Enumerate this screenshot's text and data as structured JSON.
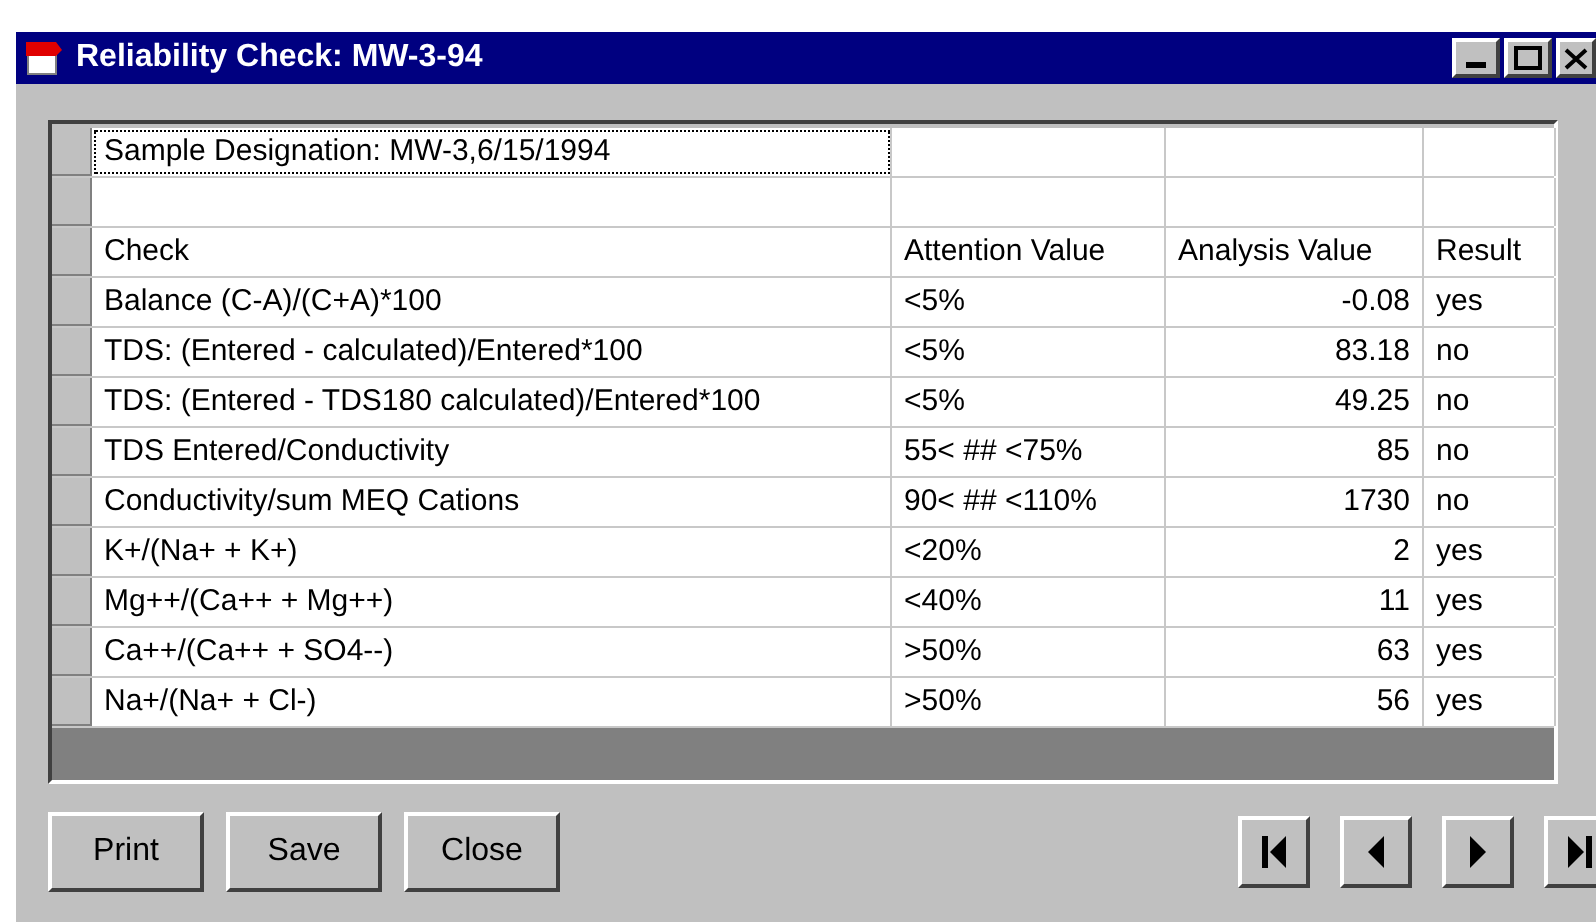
{
  "window": {
    "title": "Reliability Check: MW-3-94"
  },
  "sample_designation": {
    "text": "Sample Designation: MW-3,6/15/1994",
    "focused": true
  },
  "table": {
    "columns": [
      "Check",
      "Attention Value",
      "Analysis Value",
      "Result"
    ],
    "rows": [
      {
        "check": "Balance (C-A)/(C+A)*100",
        "attention": "<5%",
        "analysis": "-0.08",
        "result": "yes"
      },
      {
        "check": "TDS: (Entered - calculated)/Entered*100",
        "attention": "<5%",
        "analysis": "83.18",
        "result": "no"
      },
      {
        "check": "TDS: (Entered - TDS180 calculated)/Entered*100",
        "attention": "<5%",
        "analysis": "49.25",
        "result": "no"
      },
      {
        "check": "TDS Entered/Conductivity",
        "attention": "55< ## <75%",
        "analysis": "85",
        "result": "no"
      },
      {
        "check": "Conductivity/sum MEQ Cations",
        "attention": "90< ## <110%",
        "analysis": "1730",
        "result": "no"
      },
      {
        "check": "K+/(Na+ + K+)",
        "attention": "<20%",
        "analysis": "2",
        "result": "yes"
      },
      {
        "check": "Mg++/(Ca++ + Mg++)",
        "attention": "<40%",
        "analysis": "11",
        "result": "yes"
      },
      {
        "check": "Ca++/(Ca++ + SO4--)",
        "attention": ">50%",
        "analysis": "63",
        "result": "yes"
      },
      {
        "check": "Na+/(Na+ + Cl-)",
        "attention": ">50%",
        "analysis": "56",
        "result": "yes"
      }
    ]
  },
  "buttons": [
    "Print",
    "Save",
    "Close"
  ],
  "navigation": [
    {
      "kind": "first"
    },
    {
      "kind": "previous"
    },
    {
      "kind": "next"
    },
    {
      "kind": "last"
    }
  ]
}
